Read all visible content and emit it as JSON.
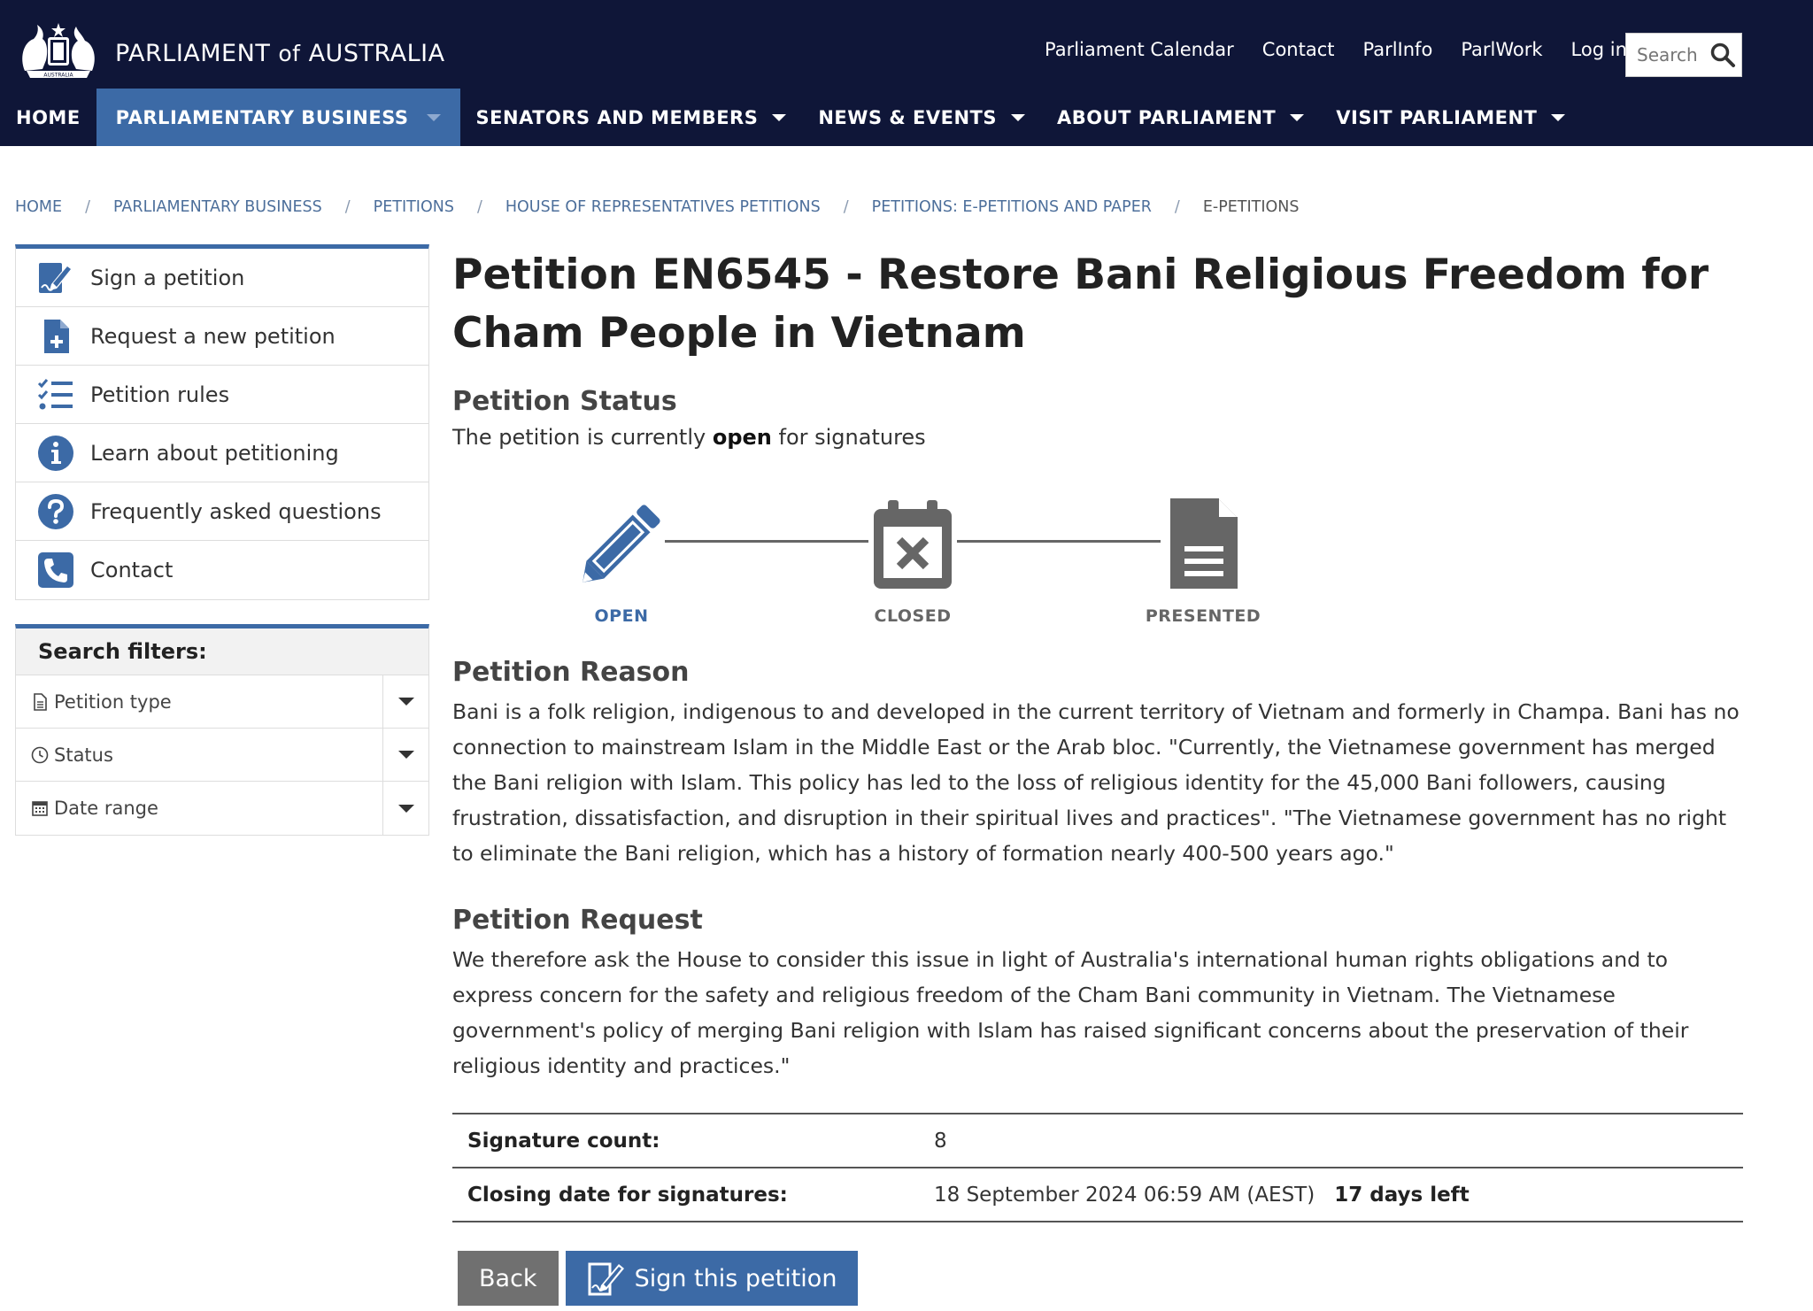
{
  "header": {
    "brand": {
      "prefix": "PARLIAMENT ",
      "of": "of",
      "suffix": " AUSTRALIA",
      "crest_text": "AUSTRALIA"
    },
    "utility_links": [
      "Parliament Calendar",
      "Contact",
      "ParlInfo",
      "ParlWork",
      "Log in"
    ],
    "search_placeholder": "Search",
    "nav": [
      "HOME",
      "PARLIAMENTARY BUSINESS",
      "SENATORS AND MEMBERS",
      "NEWS & EVENTS",
      "ABOUT PARLIAMENT",
      "VISIT PARLIAMENT"
    ],
    "active_nav": "PARLIAMENTARY BUSINESS",
    "colors": {
      "header_bg": "#0f1638",
      "accent": "#3c6aa6"
    }
  },
  "breadcrumb": [
    "HOME",
    "PARLIAMENTARY BUSINESS",
    "PETITIONS",
    "HOUSE OF REPRESENTATIVES PETITIONS",
    "PETITIONS: E-PETITIONS AND PAPER",
    "E-PETITIONS"
  ],
  "sidebar": {
    "items": [
      {
        "label": "Sign a petition",
        "icon": "sign-pen-icon"
      },
      {
        "label": "Request a new petition",
        "icon": "file-plus-icon"
      },
      {
        "label": "Petition rules",
        "icon": "checklist-icon"
      },
      {
        "label": "Learn about petitioning",
        "icon": "info-icon"
      },
      {
        "label": "Frequently asked questions",
        "icon": "question-icon"
      },
      {
        "label": "Contact",
        "icon": "phone-icon"
      }
    ],
    "filters_title": "Search filters:",
    "filters": [
      {
        "label": "Petition type",
        "icon": "document-icon"
      },
      {
        "label": "Status",
        "icon": "clock-icon"
      },
      {
        "label": "Date range",
        "icon": "calendar-icon"
      }
    ]
  },
  "petition": {
    "title": "Petition EN6545 - Restore Bani Religious Freedom for Cham People in Vietnam",
    "status_heading": "Petition Status",
    "status_text_before": "The petition is currently ",
    "status_word": "open",
    "status_text_after": " for signatures",
    "stages": [
      {
        "label": "OPEN",
        "icon": "pencil-icon",
        "active": true
      },
      {
        "label": "CLOSED",
        "icon": "calendar-x-icon",
        "active": false
      },
      {
        "label": "PRESENTED",
        "icon": "document-icon",
        "active": false
      }
    ],
    "reason_heading": "Petition Reason",
    "reason": "Bani is a folk religion, indigenous to and developed in the current territory of Vietnam and formerly in Champa. Bani has no connection to mainstream Islam in the Middle East or the Arab bloc. \"Currently, the Vietnamese government has merged the Bani religion with Islam. This policy has led to the loss of religious identity for the 45,000 Bani followers, causing frustration, dissatisfaction, and disruption in their spiritual lives and practices\". \"The Vietnamese government has no right to eliminate the Bani religion, which has a history of formation nearly 400-500 years ago.\"",
    "request_heading": "Petition Request",
    "request": "We therefore ask the House to consider this issue in light of Australia's international human rights obligations and to express concern for the safety and religious freedom of the Cham Bani community in Vietnam. The Vietnamese government's policy of merging Bani religion with Islam has raised significant concerns about the preservation of their religious identity and practices.\"",
    "signature_label": "Signature count:",
    "signature_count": "8",
    "closing_label": "Closing date for signatures:",
    "closing_date": "18 September 2024 06:59 AM (AEST)",
    "days_left": "17 days left",
    "back_label": "Back",
    "sign_label": "Sign this petition"
  }
}
